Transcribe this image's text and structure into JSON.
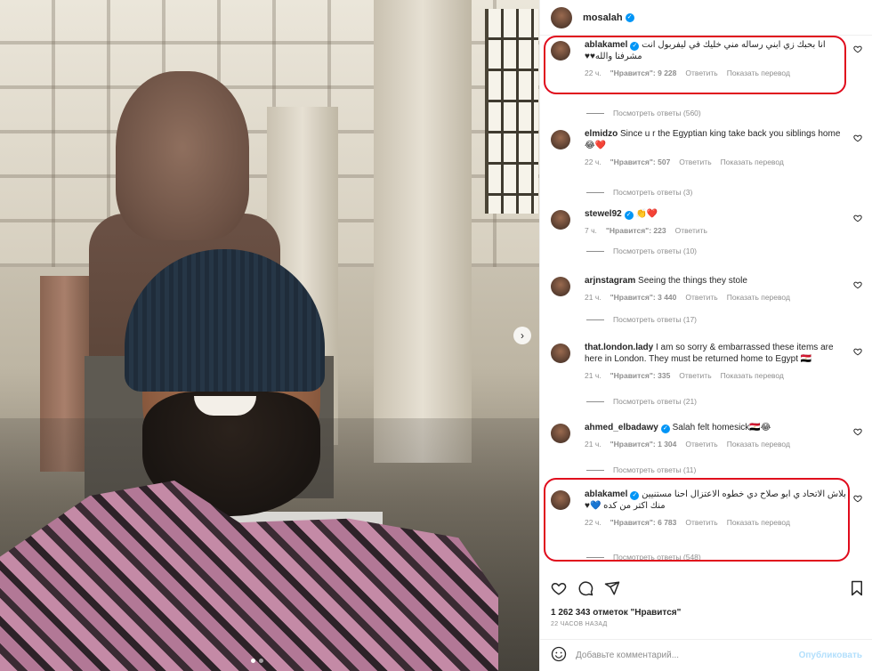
{
  "post": {
    "author": "mosalah",
    "photo_dots": 2,
    "photo_active_dot": 0
  },
  "comments": [
    {
      "user": "ablakamel",
      "verified": true,
      "text": "انا بحبك زي ابني رساله مني خليك في ليفربول انت مشرفنا والله♥♥",
      "time": "22 ч.",
      "likes": "\"Нравится\": 9 228",
      "reply": "Ответить",
      "translate": "Показать перевод",
      "view_replies": "Посмотреть ответы (560)",
      "highlighted": true
    },
    {
      "user": "elmidzo",
      "verified": false,
      "text": "Since u r the Egyptian king take back you siblings home 😂❤️",
      "time": "22 ч.",
      "likes": "\"Нравится\": 507",
      "reply": "Ответить",
      "translate": "Показать перевод",
      "view_replies": "Посмотреть ответы (3)",
      "highlighted": false
    },
    {
      "user": "stewel92",
      "verified": true,
      "text": "👏❤️",
      "time": "7 ч.",
      "likes": "\"Нравится\": 223",
      "reply": "Ответить",
      "translate": "",
      "view_replies": "Посмотреть ответы (10)",
      "highlighted": false
    },
    {
      "user": "arjnstagram",
      "verified": false,
      "text": "Seeing the things they stole",
      "time": "21 ч.",
      "likes": "\"Нравится\": 3 440",
      "reply": "Ответить",
      "translate": "Показать перевод",
      "view_replies": "Посмотреть ответы (17)",
      "highlighted": false
    },
    {
      "user": "that.london.lady",
      "verified": false,
      "text": "I am so sorry & embarrassed these items are here in London. They must be returned home to Egypt 🇪🇬",
      "time": "21 ч.",
      "likes": "\"Нравится\": 335",
      "reply": "Ответить",
      "translate": "Показать перевод",
      "view_replies": "Посмотреть ответы (21)",
      "highlighted": false
    },
    {
      "user": "ahmed_elbadawy",
      "verified": true,
      "text": "Salah felt homesick🇪🇬😂",
      "time": "21 ч.",
      "likes": "\"Нравится\": 1 304",
      "reply": "Ответить",
      "translate": "Показать перевод",
      "view_replies": "Посмотреть ответы (11)",
      "highlighted": false
    },
    {
      "user": "ablakamel",
      "verified": true,
      "text": "بلاش الاتحاد ي ابو صلاح دي خطوه الاعتزال احنا مستنيين منك اكتر من كده 💙♥",
      "time": "22 ч.",
      "likes": "\"Нравится\": 6 783",
      "reply": "Ответить",
      "translate": "Показать перевод",
      "view_replies": "Посмотреть ответы (548)",
      "highlighted": true
    }
  ],
  "footer": {
    "likes_count": "1 262 343 отметок \"Нравится\"",
    "time_ago": "22 ЧАСОВ НАЗАД",
    "comment_placeholder": "Добавьте комментарий...",
    "post_label": "Опубликовать"
  },
  "colors": {
    "verified": "#0095f6",
    "highlight_box": "#e00b1c",
    "muted_text": "#8e8e8e",
    "post_button": "#b2dffc"
  },
  "icons": {
    "like": "heart-icon",
    "comment": "comment-icon",
    "share": "share-icon",
    "save": "bookmark-icon",
    "emoji": "emoji-icon",
    "next": "chevron-right-icon"
  }
}
